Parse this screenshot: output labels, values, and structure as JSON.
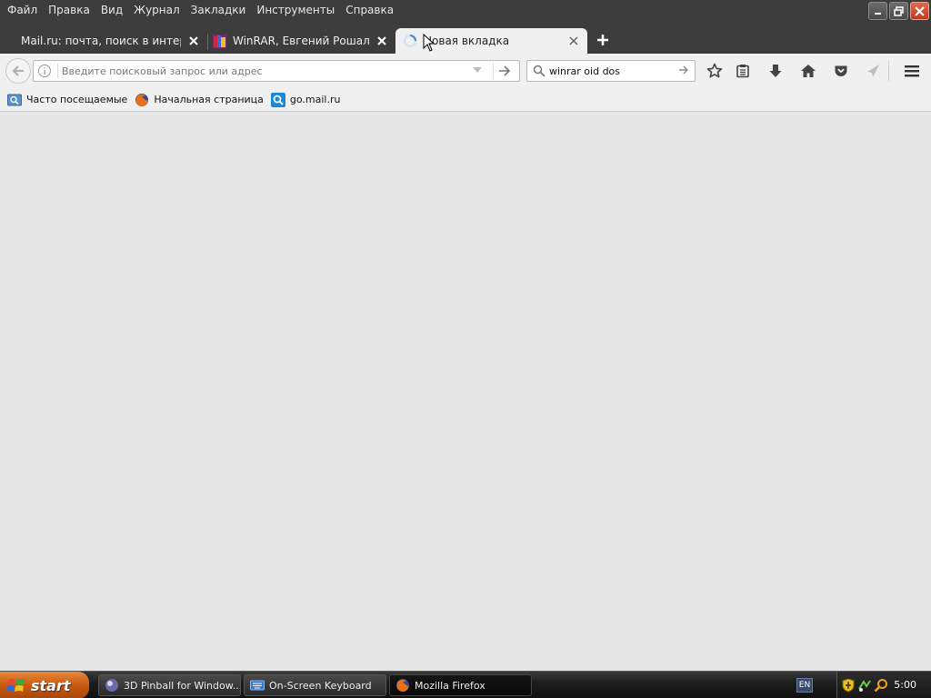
{
  "menu": [
    "Файл",
    "Правка",
    "Вид",
    "Журнал",
    "Закладки",
    "Инструменты",
    "Справка"
  ],
  "tabs": [
    {
      "label": "Mail.ru: почта, поиск в интернет..."
    },
    {
      "label": "WinRAR, Евгений Рошал - С..."
    },
    {
      "label": "Новая вкладка"
    }
  ],
  "navbar": {
    "url_placeholder": "Введите поисковый запрос или адрес",
    "search_value": "winrar oid dos"
  },
  "bookmarks": [
    "Часто посещаемые",
    "Начальная страница",
    "go.mail.ru"
  ],
  "taskbar": {
    "start_label": "start",
    "tasks": [
      "3D Pinball for Window...",
      "On-Screen Keyboard",
      "Mozilla Firefox"
    ],
    "language": "EN",
    "clock": "5:00"
  },
  "colors": {
    "chrome_dark": "#3c3c3c",
    "toolbar": "#f0f0f0",
    "content_bg": "#e6e6e6",
    "start_orange": "#c85a12",
    "loading_blue": "#3a8ee6"
  }
}
